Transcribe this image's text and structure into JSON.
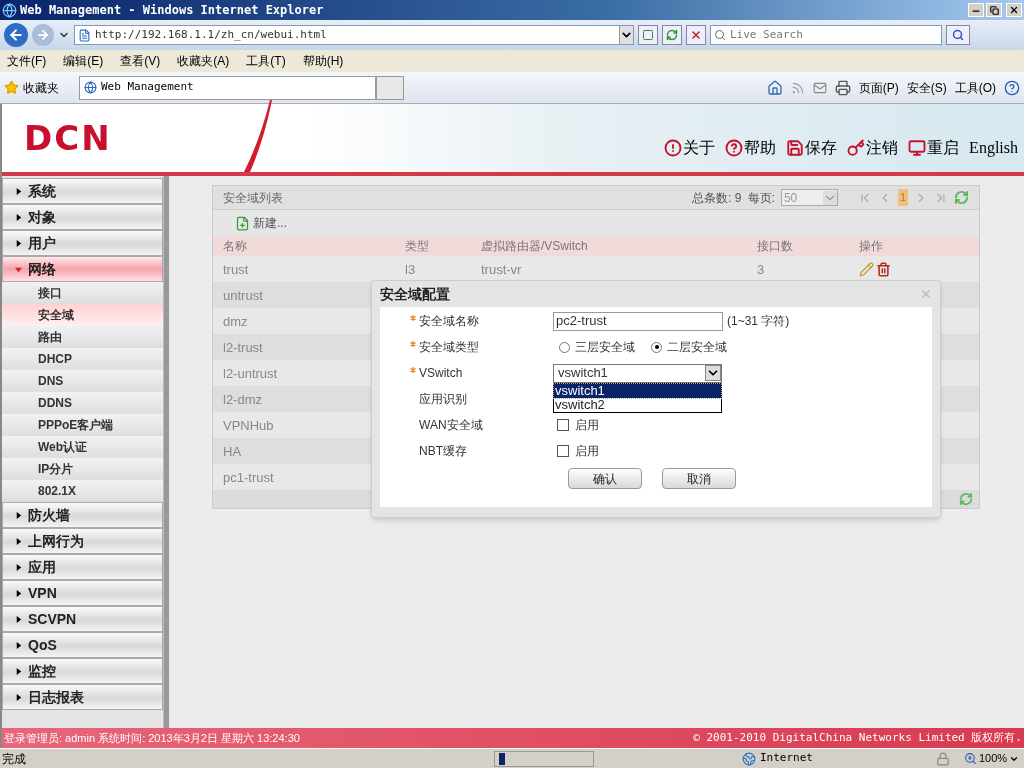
{
  "window": {
    "title": "Web Management - Windows Internet Explorer"
  },
  "address_bar": {
    "url": "http://192.168.1.1/zh_cn/webui.html"
  },
  "search": {
    "placeholder": "Live Search"
  },
  "menu": [
    "文件(F)",
    "编辑(E)",
    "查看(V)",
    "收藏夹(A)",
    "工具(T)",
    "帮助(H)"
  ],
  "favorites": {
    "label": "收藏夹"
  },
  "tabs": [
    {
      "label": "Web Management",
      "selected": true
    }
  ],
  "command_bar": [
    "页面(P)",
    "安全(S)",
    "工具(O)"
  ],
  "header": {
    "logo": "DCN",
    "links": [
      {
        "kind": "about",
        "label": "关于"
      },
      {
        "kind": "help",
        "label": "帮助"
      },
      {
        "kind": "save",
        "label": "保存"
      },
      {
        "kind": "logout",
        "label": "注销"
      },
      {
        "kind": "restart",
        "label": "重启"
      },
      {
        "kind": "language",
        "label": "English"
      }
    ]
  },
  "sidebar": {
    "items": [
      {
        "label": "系统",
        "expanded": false
      },
      {
        "label": "对象",
        "expanded": false
      },
      {
        "label": "用户",
        "expanded": false
      },
      {
        "label": "网络",
        "expanded": true,
        "children": [
          {
            "label": "接口",
            "selected": false
          },
          {
            "label": "安全域",
            "selected": true
          },
          {
            "label": "路由",
            "selected": false
          },
          {
            "label": "DHCP",
            "selected": false
          },
          {
            "label": "DNS",
            "selected": false
          },
          {
            "label": "DDNS",
            "selected": false
          },
          {
            "label": "PPPoE客户端",
            "selected": false
          },
          {
            "label": "Web认证",
            "selected": false
          },
          {
            "label": "IP分片",
            "selected": false
          },
          {
            "label": "802.1X",
            "selected": false
          }
        ]
      },
      {
        "label": "防火墙",
        "expanded": false
      },
      {
        "label": "上网行为",
        "expanded": false
      },
      {
        "label": "应用",
        "expanded": false
      },
      {
        "label": "VPN",
        "expanded": false
      },
      {
        "label": "SCVPN",
        "expanded": false
      },
      {
        "label": "QoS",
        "expanded": false
      },
      {
        "label": "监控",
        "expanded": false
      },
      {
        "label": "日志报表",
        "expanded": false
      }
    ]
  },
  "zone_list": {
    "title": "安全域列表",
    "total": "总条数: 9",
    "per_page_label": "每页:",
    "per_page": "50",
    "page": "1",
    "new_button": "新建...",
    "columns": [
      "名称",
      "类型",
      "虚拟路由器/VSwitch",
      "接口数",
      "操作"
    ],
    "rows": [
      {
        "name": "trust",
        "type": "l3",
        "router": "trust-vr",
        "interfaces": "3",
        "actions": true
      },
      {
        "name": "untrust"
      },
      {
        "name": "dmz"
      },
      {
        "name": "l2-trust"
      },
      {
        "name": "l2-untrust"
      },
      {
        "name": "l2-dmz"
      },
      {
        "name": "VPNHub"
      },
      {
        "name": "HA"
      },
      {
        "name": "pc1-trust"
      }
    ]
  },
  "dialog": {
    "title": "安全域配置",
    "fields": [
      {
        "kind": "text",
        "label": "安全域名称",
        "required": true,
        "value": "pc2-trust",
        "hint": "(1~31 字符)"
      },
      {
        "kind": "radio",
        "label": "安全域类型",
        "required": true,
        "options": [
          {
            "label": "三层安全域",
            "selected": false
          },
          {
            "label": "二层安全域",
            "selected": true
          }
        ]
      },
      {
        "kind": "select",
        "label": "VSwitch",
        "required": true,
        "value": "vswitch1",
        "expanded": true,
        "options": [
          {
            "label": "vswitch1",
            "selected": true
          },
          {
            "label": "vswitch2",
            "selected": false
          }
        ]
      },
      {
        "kind": "covered",
        "label": "应用识别",
        "required": false
      },
      {
        "kind": "checkbox",
        "label": "WAN安全域",
        "required": false,
        "text": "启用",
        "checked": false
      },
      {
        "kind": "checkbox",
        "label": "NBT缓存",
        "required": false,
        "text": "启用",
        "checked": false
      }
    ],
    "buttons": [
      "确认",
      "取消"
    ]
  },
  "footer": {
    "login": "登录管理员: admin 系统时间: 2013年3月2日 星期六 13:24:30",
    "copyright": "© 2001-2010 DigitalChina Networks Limited 版权所有."
  },
  "status_bar": {
    "text": "完成",
    "zone": "Internet",
    "zoom": "100%"
  }
}
